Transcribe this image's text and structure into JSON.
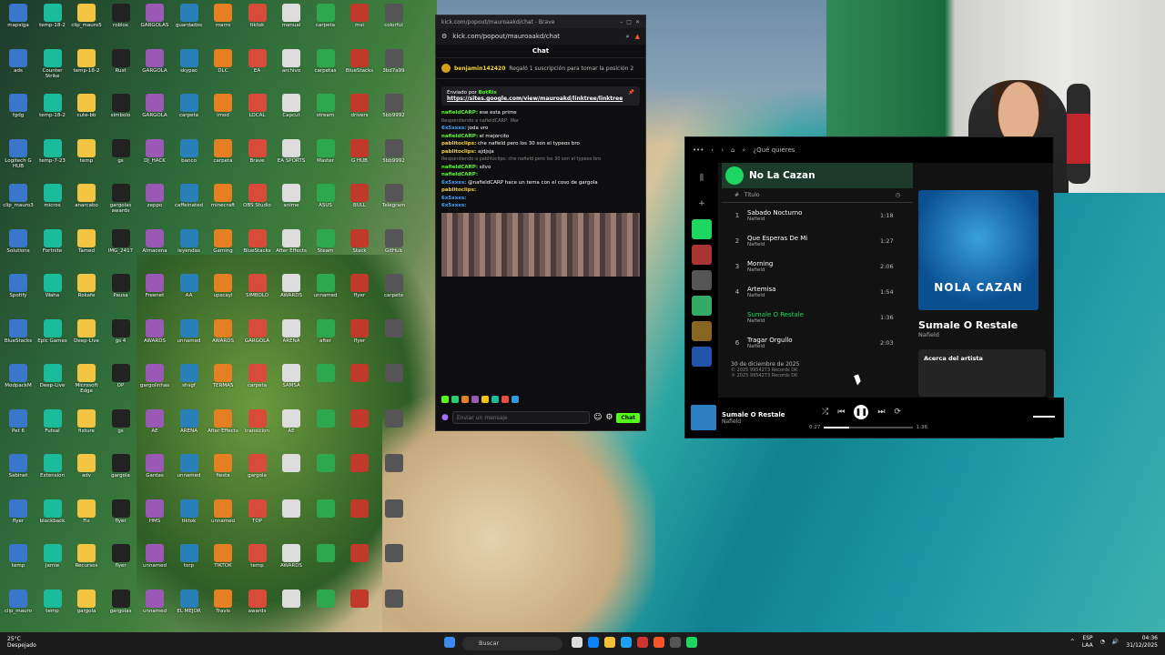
{
  "desktop": {
    "icons": [
      "mapsiga",
      "temp-18-2",
      "clip_mauro5",
      "roblox",
      "GARGOLAS",
      "guardados",
      "marro",
      "tiktok",
      "manual",
      "carpeta",
      "msi",
      "colorful",
      "ads",
      "Counter Strike",
      "temp-18-2",
      "Rust",
      "GARGOLA",
      "skypac",
      "DLC",
      "EA",
      "archivo",
      "carpetas",
      "BlueStacks",
      "3bd7a99",
      "fgdg",
      "temp-18-2",
      "cute-bb",
      "simbolo",
      "GARGOLA",
      "carpeta",
      "imod",
      "LOCAL",
      "Capcut",
      "stream",
      "drivers",
      "5bb9992",
      "Logitech G HUB",
      "temp-7-23",
      "temp",
      "gs",
      "DJ_HACK",
      "banco",
      "carpeta",
      "Brave",
      "EA SPORTS",
      "Master",
      "G HUB",
      "5bb9992",
      "clip_mauro3",
      "micros",
      "anarcabo",
      "gargolas awards",
      "zeppo",
      "caffeinated",
      "minecraft",
      "OBS Studio",
      "anime",
      "ASUS",
      "BULL",
      "Telegram",
      "Solutions",
      "Fortnite",
      "Tamed",
      "IMG_2417",
      "Almacena",
      "leyendas",
      "Gaming",
      "BlueStacks",
      "After Effects",
      "Steam",
      "Stack",
      "GitHub",
      "Spotify",
      "Waha",
      "Rokafe",
      "Pausa",
      "Freenet",
      "AA",
      "upscayl",
      "SIMBOLO",
      "AWARDS",
      "unnamed",
      "flyer",
      "carpeta",
      "BlueStacks",
      "Epic Games",
      "Deep-Live",
      "gs 4",
      "AWARDS",
      "unnamed",
      "AWARDS",
      "GARGOLA",
      "ARENA",
      "after",
      "flyer",
      "",
      "ModpackM",
      "Deep-Live",
      "Microsoft Edge",
      "OP",
      "gargolinhas",
      "shsgf",
      "TERMAS",
      "carpeta",
      "SAMSA",
      "",
      "",
      "",
      "Pet 6",
      "Futsal",
      "fixture",
      "gs",
      "AE",
      "ARENA",
      "After Effects",
      "transicion",
      "AE",
      "",
      "",
      "",
      "Sabinet",
      "Extension",
      "adv",
      "gargola",
      "Gardas",
      "unnamed",
      "fiesta",
      "gargola",
      "",
      "",
      "",
      "",
      "flyer",
      "blackback",
      "Fix",
      "flyer",
      "HMS",
      "tiktok",
      "unnamed",
      "TOP",
      "",
      "",
      "",
      "",
      "temp",
      "Jamie",
      "Recursos",
      "flyer",
      "unnamed",
      "torp",
      "TIKTOK",
      "temp",
      "AWARDS",
      "",
      "",
      "",
      "clip_mauro",
      "temp",
      "gargola",
      "gargolas",
      "unnamed",
      "EL MEJOR",
      "Travis",
      "awards",
      "",
      "",
      "",
      ""
    ]
  },
  "browser": {
    "url": "kick.com/popout/mauroaakd/chat",
    "window_title": "kick.com/popout/mauroaakd/chat - Brave",
    "chat_title": "Chat",
    "sub_user": "benjamin142420",
    "sub_text": "Regaló 1 suscripción para tomar la posición 2",
    "pinned_by": "Enviado por",
    "pinned_user": "BotRix",
    "pinned_link": "https://sites.google.com/view/mauroakd/linktree/linktree",
    "messages": [
      {
        "user": "nafieldCARP:",
        "text": "ese esta prime",
        "cls": "u"
      },
      {
        "reply": "Respondiendo a nafieldCARP: War"
      },
      {
        "user": "6x5xxxs:",
        "text": "joda vro",
        "cls": "u2"
      },
      {
        "user": "nafieldCARP:",
        "text": "el mejorcito",
        "cls": "u"
      },
      {
        "user": "pablitoclips:",
        "text": "che nafield pero los 30 son el typeos bro",
        "cls": "u3"
      },
      {
        "user": "pablitoclips:",
        "text": "ajdjsja",
        "cls": "u3"
      },
      {
        "reply": "Respondiendo a pablitoclips: che nafield pero los 30 son el typeos bro"
      },
      {
        "user": "nafieldCARP:",
        "text": "silvo",
        "cls": "u"
      },
      {
        "user": "nafieldCARP:",
        "text": "",
        "cls": "u"
      },
      {
        "user": "6x5xxxs:",
        "text": "@nafieldCARP hace un tema con el coso de gargola",
        "cls": "u2"
      },
      {
        "user": "pablitoclips:",
        "text": "",
        "cls": "u3"
      },
      {
        "user": "6x5xxxs:",
        "text": "",
        "cls": "u2"
      },
      {
        "user": "6x5xxxs:",
        "text": "",
        "cls": "u2"
      }
    ],
    "input_placeholder": "Enviar un mensaje",
    "send_label": "Chat"
  },
  "spotify": {
    "search_placeholder": "¿Qué quieres",
    "playlist_title": "No La Cazan",
    "col_title": "Título",
    "tracks": [
      {
        "n": "1",
        "name": "Sabado Nocturno",
        "artist": "Nafield",
        "dur": "1:18"
      },
      {
        "n": "2",
        "name": "Que Esperas De Mi",
        "artist": "Nafield",
        "dur": "1:27"
      },
      {
        "n": "3",
        "name": "Morning",
        "artist": "Nafield",
        "dur": "2:06"
      },
      {
        "n": "4",
        "name": "Artemisa",
        "artist": "Nafield",
        "dur": "1:54"
      },
      {
        "n": "",
        "name": "Sumale O Restale",
        "artist": "Nafield",
        "dur": "1:36"
      },
      {
        "n": "6",
        "name": "Tragar Orgullo",
        "artist": "Nafield",
        "dur": "2:03"
      }
    ],
    "release_date": "30 de diciembre de 2025",
    "copyright1": "© 2025 9954273 Records DK",
    "copyright2": "℗ 2025 9954273 Records DK",
    "now_playing_title": "Sumale O Restale",
    "now_playing_artist": "Nafield",
    "about_label": "Acerca del artista",
    "cover_text": "NOLA CAZAN",
    "elapsed": "0:27",
    "total": "1:36",
    "progress": 0.28,
    "accent": "#1ed760"
  },
  "taskbar": {
    "temp": "25°C",
    "weather": "Despejado",
    "search": "Buscar",
    "lang": "ESP",
    "lang2": "LAA",
    "time": "04:36",
    "date": "31/12/2025"
  }
}
